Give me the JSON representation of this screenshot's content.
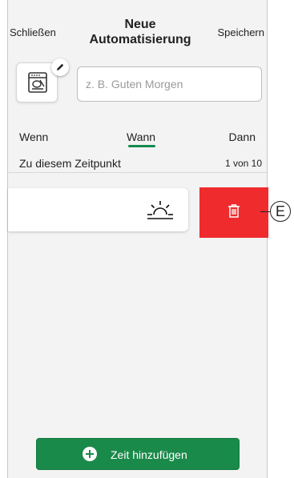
{
  "header": {
    "close_label": "Schließen",
    "title_line1": "Neue",
    "title_line2": "Automatisierung",
    "save_label": "Speichern"
  },
  "name_field": {
    "placeholder": "z. B. Guten Morgen",
    "value": ""
  },
  "tabs": [
    {
      "label": "Wenn",
      "active": false
    },
    {
      "label": "Wann",
      "active": true
    },
    {
      "label": "Dann",
      "active": false
    }
  ],
  "section": {
    "title": "Zu diesem Zeitpunkt",
    "count": "1 von 10"
  },
  "condition_item": {
    "icon": "sunrise-icon"
  },
  "delete_action": {
    "icon": "trash-icon"
  },
  "callout_label": "E",
  "add_button": {
    "label": "Zeit hinzufügen",
    "icon": "plus-circle-icon"
  },
  "colors": {
    "accent": "#138a4e",
    "delete": "#ef2b2d",
    "button": "#1a8a4a"
  }
}
